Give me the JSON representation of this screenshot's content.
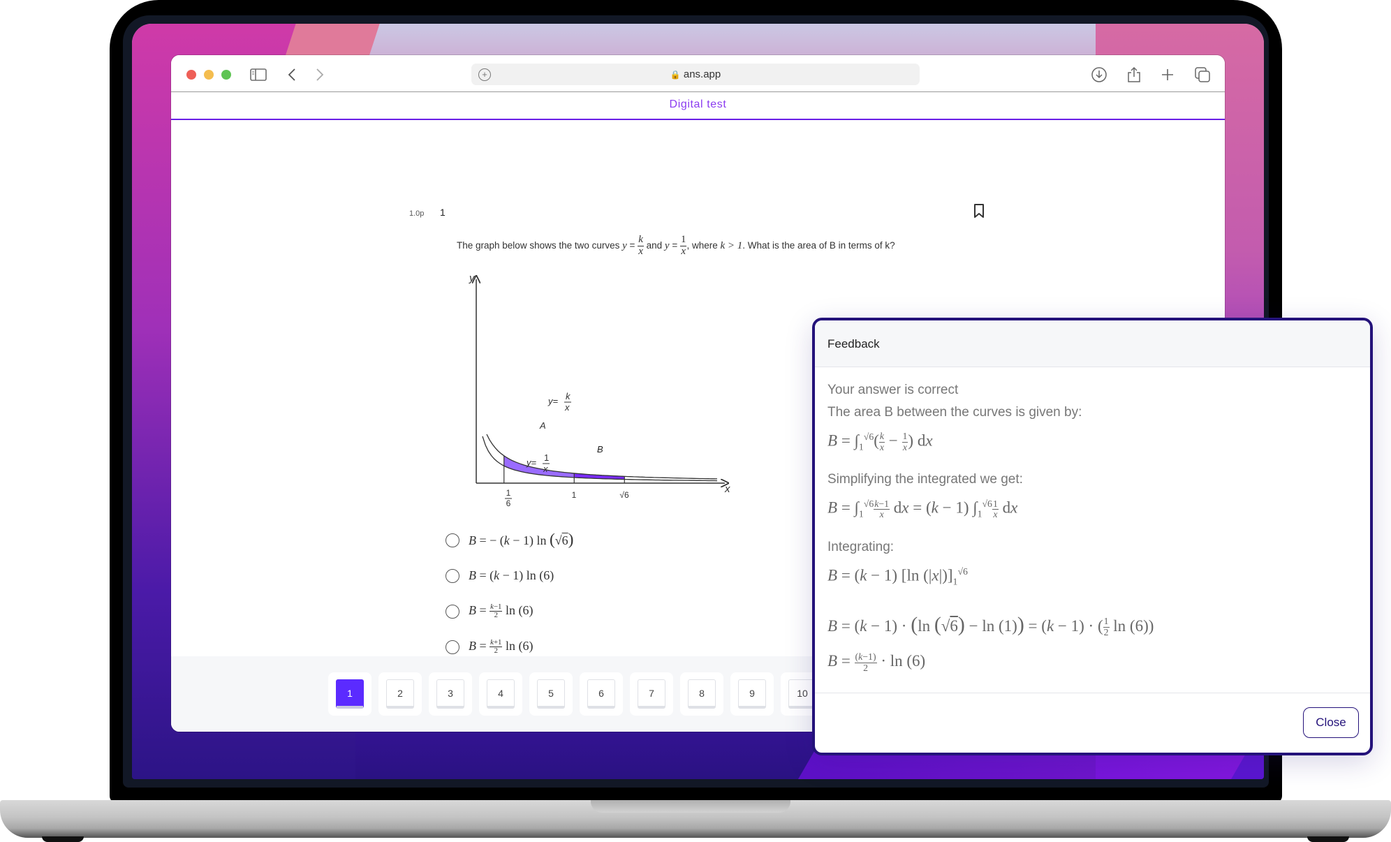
{
  "browser": {
    "url": "ans.app",
    "icons": [
      "sidebar-icon",
      "back-icon",
      "forward-icon",
      "download-icon",
      "share-icon",
      "new-tab-icon",
      "tabs-icon"
    ]
  },
  "app": {
    "title": "Digital test"
  },
  "question": {
    "points": "1.0p",
    "number": "1",
    "text_before": "The graph below shows the two curves ",
    "curve1": "y = k/x",
    "text_and": " and ",
    "curve2": "y = 1/x",
    "text_where": ", where ",
    "condition": "k > 1",
    "text_after": ". What is the area of B in terms of k?",
    "graph": {
      "x_axis_label": "x",
      "y_axis_label": "y",
      "x_ticks": [
        "1/6",
        "1",
        "√6"
      ],
      "curve_labels": [
        "y = k/x",
        "y = 1/x"
      ],
      "region_labels": [
        "A",
        "B"
      ],
      "region_a_color": "#9a6cff",
      "region_b_color": "#7a2cff"
    },
    "options": [
      "B = −(k − 1) ln(√6)",
      "B = (k − 1) ln(6)",
      "B = ((k−1)/2) ln(6)",
      "B = ((k+1)/2) ln(6)"
    ]
  },
  "pagination": {
    "pages": [
      "1",
      "2",
      "3",
      "4",
      "5",
      "6",
      "7",
      "8",
      "9",
      "10"
    ],
    "active": "1",
    "active_color": "#5b2bff"
  },
  "feedback": {
    "title": "Feedback",
    "status": "Your answer is correct",
    "intro": "The area B between the curves is given by:",
    "eq1": "B = ∫₁^√6 (k/x − 1/x) dx",
    "step2_label": "Simplifying the integrated we get:",
    "eq2": "B = ∫₁^√6 (k−1)/x dx = (k − 1) ∫₁^√6 1/x dx",
    "step3_label": "Integrating:",
    "eq3": "B = (k − 1) [ln(|x|)]₁^√6",
    "eq4": "B = (k − 1) · (ln(√6) − ln(1)) = (k − 1) · (½ ln(6))",
    "eq5": "B = ((k−1)/2) · ln(6)",
    "close_label": "Close",
    "border_color": "#24127a"
  }
}
